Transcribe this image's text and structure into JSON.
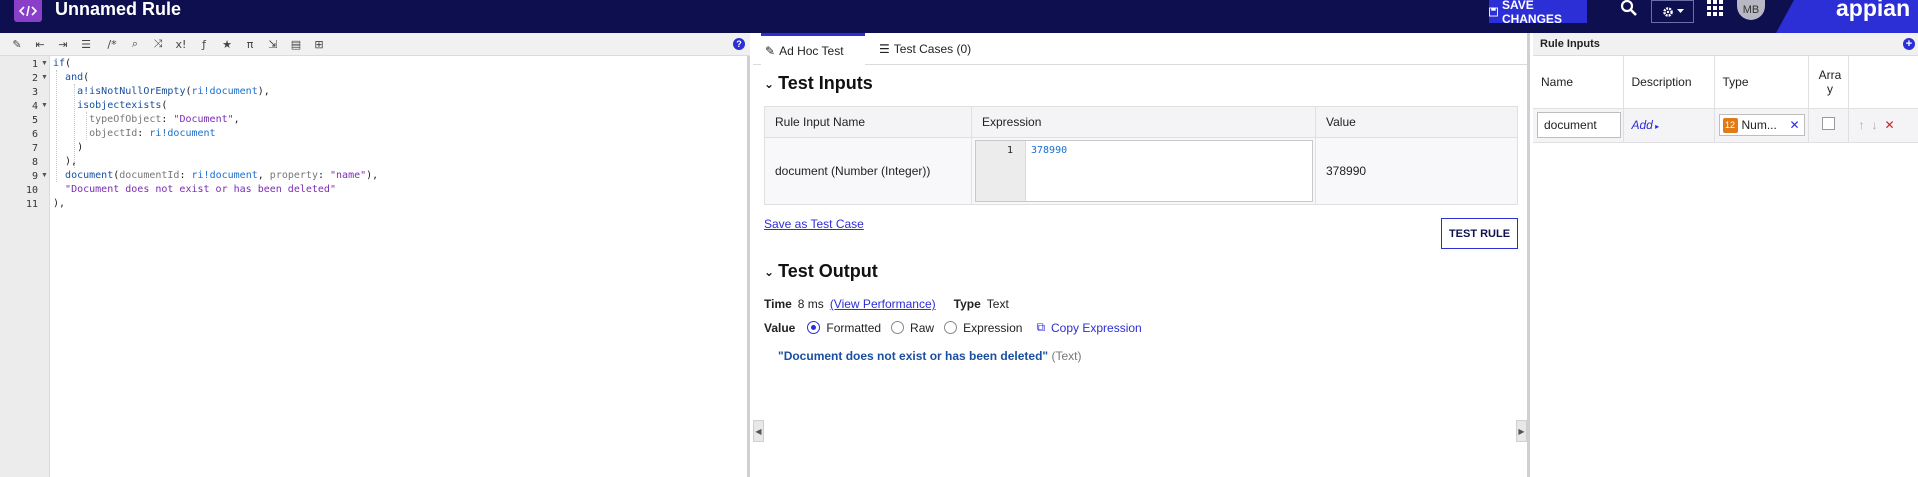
{
  "header": {
    "title": "Unnamed Rule",
    "save_label": "SAVE CHANGES",
    "avatar_initials": "MB",
    "brand": "appian",
    "colors": {
      "bar": "#0d0f4f",
      "accent": "#2c2ed6",
      "logo": "#8a3fc9"
    }
  },
  "editor": {
    "toolbar_icons": [
      "magic-wand-icon",
      "outdent-icon",
      "indent-icon",
      "list-icon",
      "comment-icon",
      "search-icon",
      "shuffle-icon",
      "variable-icon",
      "function-icon",
      "star-icon",
      "pi-icon",
      "export-icon",
      "template-icon",
      "sql-icon"
    ],
    "lines": [
      {
        "n": "1",
        "fold": true,
        "text": "if("
      },
      {
        "n": "2",
        "fold": true,
        "text": "  and("
      },
      {
        "n": "3",
        "fold": false,
        "text": "    a!isNotNullOrEmpty(ri!document),"
      },
      {
        "n": "4",
        "fold": true,
        "text": "    isobjectexists("
      },
      {
        "n": "5",
        "fold": false,
        "text": "      typeOfObject: \"Document\","
      },
      {
        "n": "6",
        "fold": false,
        "text": "      objectId: ri!document"
      },
      {
        "n": "7",
        "fold": false,
        "text": "    )"
      },
      {
        "n": "8",
        "fold": false,
        "text": "  ),"
      },
      {
        "n": "9",
        "fold": true,
        "text": "  document(documentId: ri!document, property: \"name\"),"
      },
      {
        "n": "10",
        "fold": false,
        "text": "  \"Document does not exist or has been deleted\""
      },
      {
        "n": "11",
        "fold": false,
        "text": "),"
      }
    ]
  },
  "tabs": [
    {
      "label": "Ad Hoc Test",
      "icon": "edit-icon",
      "active": true
    },
    {
      "label": "Test Cases (0)",
      "icon": "list-icon",
      "active": false
    }
  ],
  "test_inputs": {
    "title": "Test Inputs",
    "columns": [
      "Rule Input Name",
      "Expression",
      "Value"
    ],
    "rows": [
      {
        "name": "document (Number (Integer))",
        "line": "1",
        "expression": "378990",
        "value": "378990"
      }
    ],
    "save_case": "Save as Test Case",
    "test_button": "TEST RULE"
  },
  "test_output": {
    "title": "Test Output",
    "time_label": "Time",
    "time_value": "8 ms",
    "view_perf": "(View Performance)",
    "type_label": "Type",
    "type_value": "Text",
    "value_label": "Value",
    "modes": [
      "Formatted",
      "Raw",
      "Expression"
    ],
    "selected_mode": "Formatted",
    "copy_label": "Copy Expression",
    "result": "\"Document does not exist or has been deleted\"",
    "result_type": "(Text)"
  },
  "rule_inputs": {
    "title": "Rule Inputs",
    "columns": [
      "Name",
      "Description",
      "Type",
      "Array"
    ],
    "rows": [
      {
        "name": "document",
        "description": "Add",
        "type": "Num...",
        "array": false
      }
    ]
  }
}
